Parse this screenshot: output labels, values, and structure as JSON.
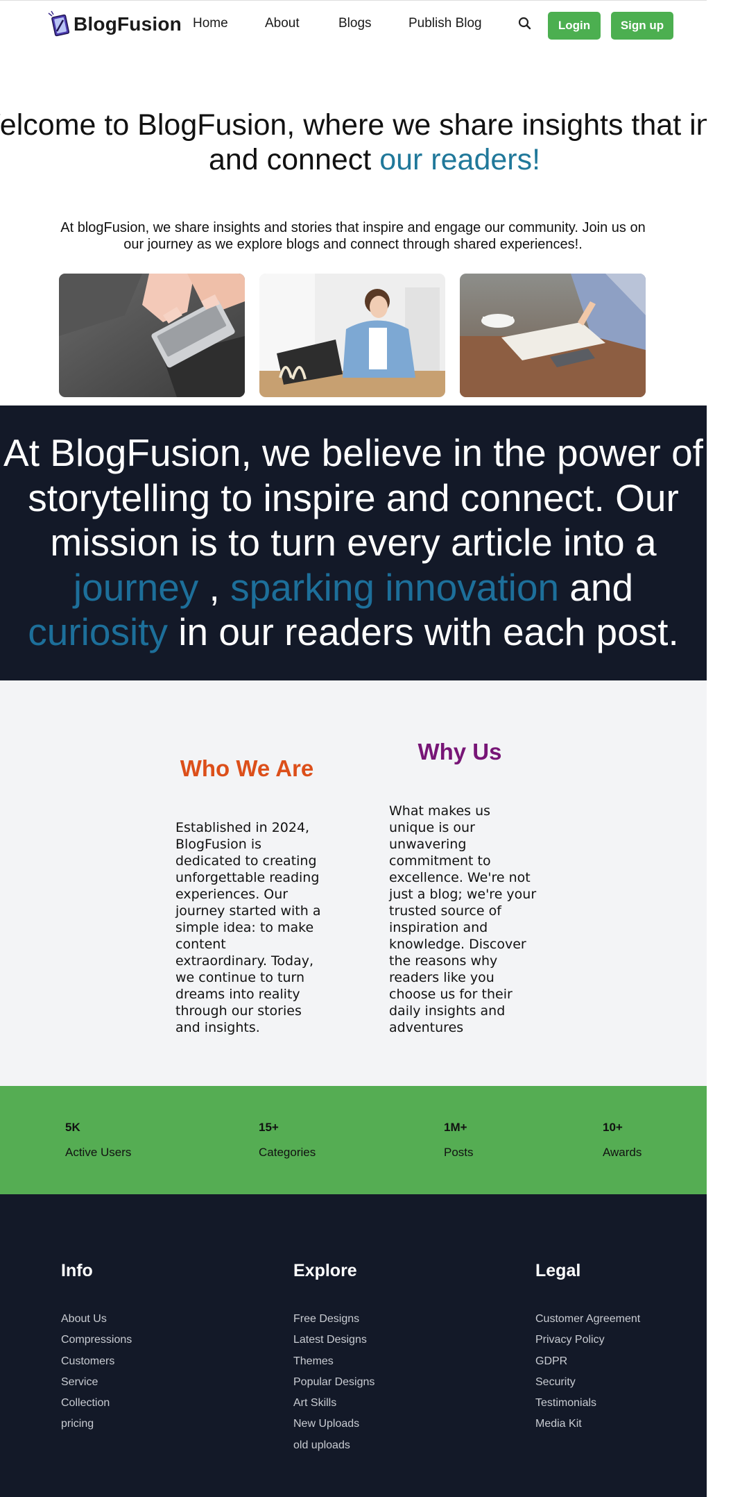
{
  "nav": {
    "brand": "BlogFusion",
    "links": [
      "Home",
      "About",
      "Blogs",
      "Publish Blog"
    ],
    "login": "Login",
    "signup": "Sign up"
  },
  "hero": {
    "title_line1": "Welcome to BlogFusion, where we share insights that inspire",
    "title_line2_prefix": "and connect ",
    "title_line2_accent": "our readers!",
    "subtitle": "At blogFusion, we share insights and stories that inspire and engage our community. Join us on our journey as we explore blogs and connect through shared experiences!."
  },
  "mission": {
    "line1": "At BlogFusion, we believe in the power of",
    "line2": "storytelling to inspire and connect. Our",
    "line3": "mission is to turn every article into a",
    "accent1": "journey",
    "sep": " , ",
    "accent2": "sparking innovation",
    "and": " and",
    "accent3": "curiosity",
    "tail": " in our readers with each post."
  },
  "about": {
    "who_title": "Who We Are",
    "who_body": "Established in 2024, BlogFusion is dedicated to creating unforgettable reading experiences. Our journey started with a simple idea: to make content extraordinary. Today, we continue to turn dreams into reality through our stories and insights.",
    "why_title": "Why Us",
    "why_body": "What makes us unique is our unwavering commitment to excellence. We're not just a blog; we're your trusted source of inspiration and knowledge. Discover the reasons why readers like you choose us for their daily insights and adventures"
  },
  "stats": [
    {
      "value": "5K",
      "label": "Active Users"
    },
    {
      "value": "15+",
      "label": "Categories"
    },
    {
      "value": "1M+",
      "label": "Posts"
    },
    {
      "value": "10+",
      "label": "Awards"
    }
  ],
  "footer": {
    "info": {
      "title": "Info",
      "links": [
        "About Us",
        "Compressions",
        "Customers",
        "Service",
        "Collection",
        "pricing"
      ]
    },
    "explore": {
      "title": "Explore",
      "links": [
        "Free Designs",
        "Latest Designs",
        "Themes",
        "Popular Designs",
        "Art Skills",
        "New Uploads",
        "old uploads"
      ]
    },
    "legal": {
      "title": "Legal",
      "links": [
        "Customer Agreement",
        "Privacy Policy",
        "GDPR",
        "Security",
        "Testimonials",
        "Media Kit"
      ]
    }
  },
  "colors": {
    "accent_blue": "#20789a",
    "mission_accent": "#1d6f9a",
    "button_green": "#4caf50",
    "stats_green": "#55ad53",
    "dark_navy": "#131928",
    "who_orange": "#dc4f1a",
    "why_purple": "#771576"
  },
  "icons": {
    "logo": "book-pen-logo-icon",
    "search": "search-icon"
  }
}
